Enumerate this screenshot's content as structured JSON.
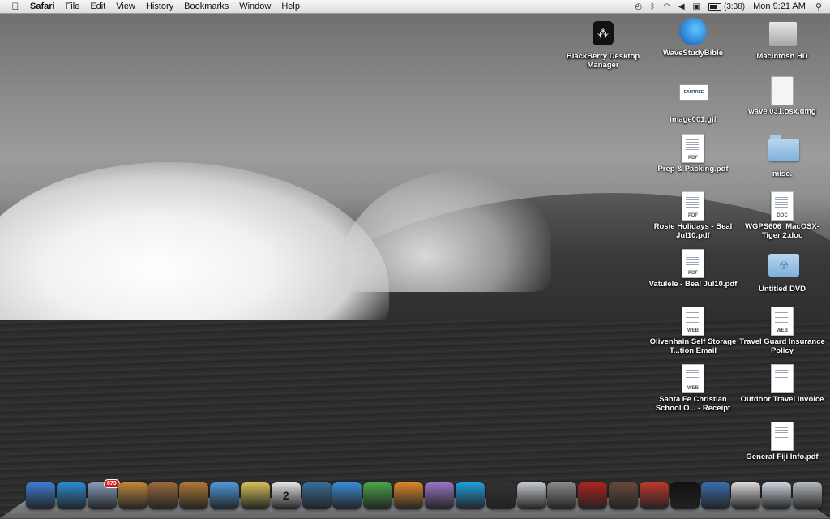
{
  "menubar": {
    "apple_glyph": "",
    "app_name": "Safari",
    "menus": [
      "File",
      "Edit",
      "View",
      "History",
      "Bookmarks",
      "Window",
      "Help"
    ],
    "battery_time": "(3:38)",
    "clock": "Mon 9:21 AM",
    "status_icons": [
      "time-machine-icon",
      "bluetooth-icon",
      "wifi-icon",
      "volume-icon",
      "input-menu-icon",
      "battery-icon",
      "spotlight-icon"
    ]
  },
  "desktop_icons": [
    {
      "label": "BlackBerry Desktop Manager",
      "icon": "blackberry-icon"
    },
    {
      "label": "WaveStudyBible",
      "icon": "wave-app-icon"
    },
    {
      "label": "Macintosh HD",
      "icon": "hard-drive-icon"
    },
    {
      "label": "image001.gif",
      "icon": "image-file-icon",
      "file_tag": "EAMTREE"
    },
    {
      "label": "wave.031.osx.dmg",
      "icon": "disk-image-icon"
    },
    {
      "label": "Prep & Packing.pdf",
      "icon": "pdf-icon",
      "file_tag": "PDF"
    },
    {
      "label": "misc.",
      "icon": "folder-icon"
    },
    {
      "label": "Rosie Holidays - Beal Jul10.pdf",
      "icon": "pdf-icon",
      "file_tag": "PDF"
    },
    {
      "label": "WGPS606_MacOSX-Tiger 2.doc",
      "icon": "doc-icon",
      "file_tag": "DOC"
    },
    {
      "label": "Vatulele - Beal Jul10.pdf",
      "icon": "pdf-icon",
      "file_tag": "PDF"
    },
    {
      "label": "Untitled DVD",
      "icon": "dvd-folder-icon"
    },
    {
      "label": "Olivenhain Self Storage T...tion Email",
      "icon": "webarchive-icon",
      "file_tag": "WEB"
    },
    {
      "label": "Travel Guard Insurance Policy",
      "icon": "webarchive-icon",
      "file_tag": "WEB"
    },
    {
      "label": "Santa Fe Christian School O... - Receipt",
      "icon": "webarchive-icon",
      "file_tag": "WEB"
    },
    {
      "label": "Outdoor Travel Invoice",
      "icon": "document-icon"
    },
    {
      "label": "General Fiji Info.pdf",
      "icon": "document-icon"
    }
  ],
  "dock": {
    "mail_badge": "873",
    "ical_day": "2",
    "items": [
      {
        "name": "finder-icon",
        "color": "#3d7fd6"
      },
      {
        "name": "safari-icon",
        "color": "#2c8ed6"
      },
      {
        "name": "mail-icon",
        "color": "#8aa0c0"
      },
      {
        "name": "iphoto-icon",
        "color": "#c28a3a"
      },
      {
        "name": "photo-booth-icon",
        "color": "#9a6b3f"
      },
      {
        "name": "garageband-icon",
        "color": "#b07a38"
      },
      {
        "name": "itunes-icon",
        "color": "#4f9be0"
      },
      {
        "name": "imovie-icon",
        "color": "#d9c35a"
      },
      {
        "name": "ical-icon",
        "color": "#e8e8e8"
      },
      {
        "name": "time-machine-icon",
        "color": "#3a6f9c"
      },
      {
        "name": "word-icon",
        "color": "#3b8fd9"
      },
      {
        "name": "excel-icon",
        "color": "#4aa84a"
      },
      {
        "name": "powerpoint-icon",
        "color": "#e08a2a"
      },
      {
        "name": "entourage-icon",
        "color": "#9b77c9"
      },
      {
        "name": "skype-icon",
        "color": "#1ea1e0"
      },
      {
        "name": "dashboard-icon",
        "color": "#333333"
      },
      {
        "name": "preview-icon",
        "color": "#c8ccd2"
      },
      {
        "name": "system-preferences-icon",
        "color": "#8c8c8c"
      },
      {
        "name": "front-row-icon",
        "color": "#b0241f"
      },
      {
        "name": "photo-slides-icon",
        "color": "#6a4a3a"
      },
      {
        "name": "chair-app-icon",
        "color": "#c0392b"
      },
      {
        "name": "blackberry-dock-icon",
        "color": "#111111"
      },
      {
        "name": "dvd-player-icon",
        "color": "#3a6fb0"
      },
      {
        "name": "textedit-icon",
        "color": "#dddddd"
      },
      {
        "name": "downloads-stack-icon",
        "color": "#cfd8e0"
      },
      {
        "name": "trash-icon",
        "color": "#b8bcc0"
      }
    ]
  }
}
